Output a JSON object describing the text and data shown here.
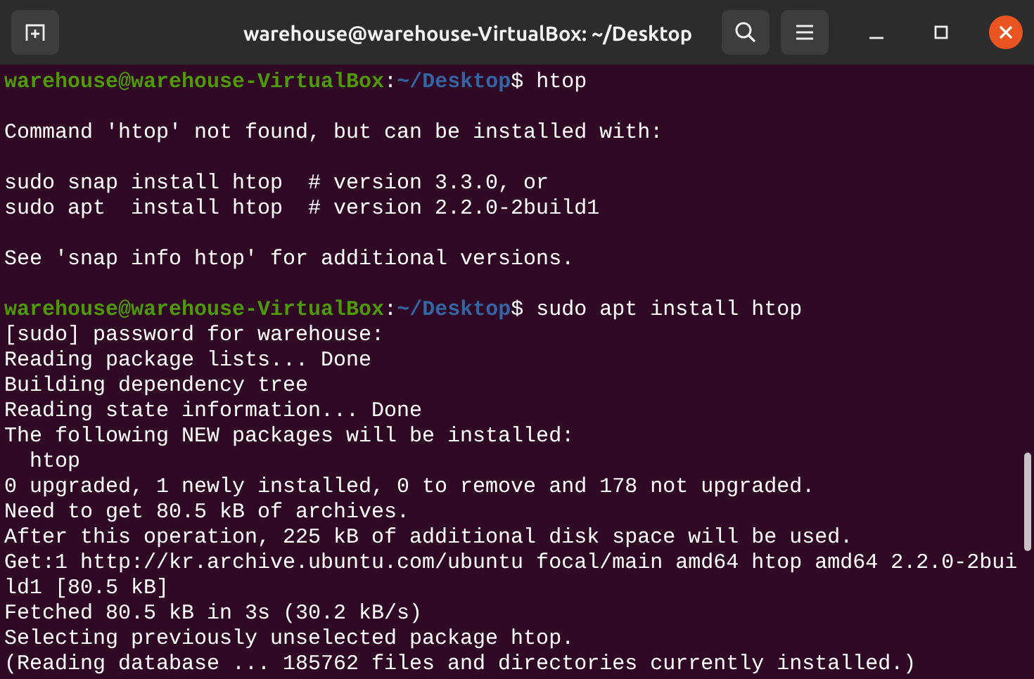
{
  "window": {
    "title": "warehouse@warehouse-VirtualBox: ~/Desktop"
  },
  "terminal": {
    "lines": [
      {
        "kind": "prompt",
        "user": "warehouse@warehouse-VirtualBox",
        "separator": ":",
        "path": "~/Desktop",
        "command": "$ htop"
      },
      {
        "kind": "blank"
      },
      {
        "kind": "output",
        "text": "Command 'htop' not found, but can be installed with:"
      },
      {
        "kind": "blank"
      },
      {
        "kind": "output",
        "text": "sudo snap install htop  # version 3.3.0, or"
      },
      {
        "kind": "output",
        "text": "sudo apt  install htop  # version 2.2.0-2build1"
      },
      {
        "kind": "blank"
      },
      {
        "kind": "output",
        "text": "See 'snap info htop' for additional versions."
      },
      {
        "kind": "blank"
      },
      {
        "kind": "prompt",
        "user": "warehouse@warehouse-VirtualBox",
        "separator": ":",
        "path": "~/Desktop",
        "command": "$ sudo apt install htop"
      },
      {
        "kind": "output",
        "text": "[sudo] password for warehouse:"
      },
      {
        "kind": "output",
        "text": "Reading package lists... Done"
      },
      {
        "kind": "output",
        "text": "Building dependency tree"
      },
      {
        "kind": "output",
        "text": "Reading state information... Done"
      },
      {
        "kind": "output",
        "text": "The following NEW packages will be installed:"
      },
      {
        "kind": "output",
        "text": "  htop"
      },
      {
        "kind": "output",
        "text": "0 upgraded, 1 newly installed, 0 to remove and 178 not upgraded."
      },
      {
        "kind": "output",
        "text": "Need to get 80.5 kB of archives."
      },
      {
        "kind": "output",
        "text": "After this operation, 225 kB of additional disk space will be used."
      },
      {
        "kind": "output",
        "text": "Get:1 http://kr.archive.ubuntu.com/ubuntu focal/main amd64 htop amd64 2.2.0-2bui"
      },
      {
        "kind": "output",
        "text": "ld1 [80.5 kB]"
      },
      {
        "kind": "output",
        "text": "Fetched 80.5 kB in 3s (30.2 kB/s)"
      },
      {
        "kind": "output",
        "text": "Selecting previously unselected package htop."
      },
      {
        "kind": "output",
        "text": "(Reading database ... 185762 files and directories currently installed.)"
      }
    ]
  }
}
